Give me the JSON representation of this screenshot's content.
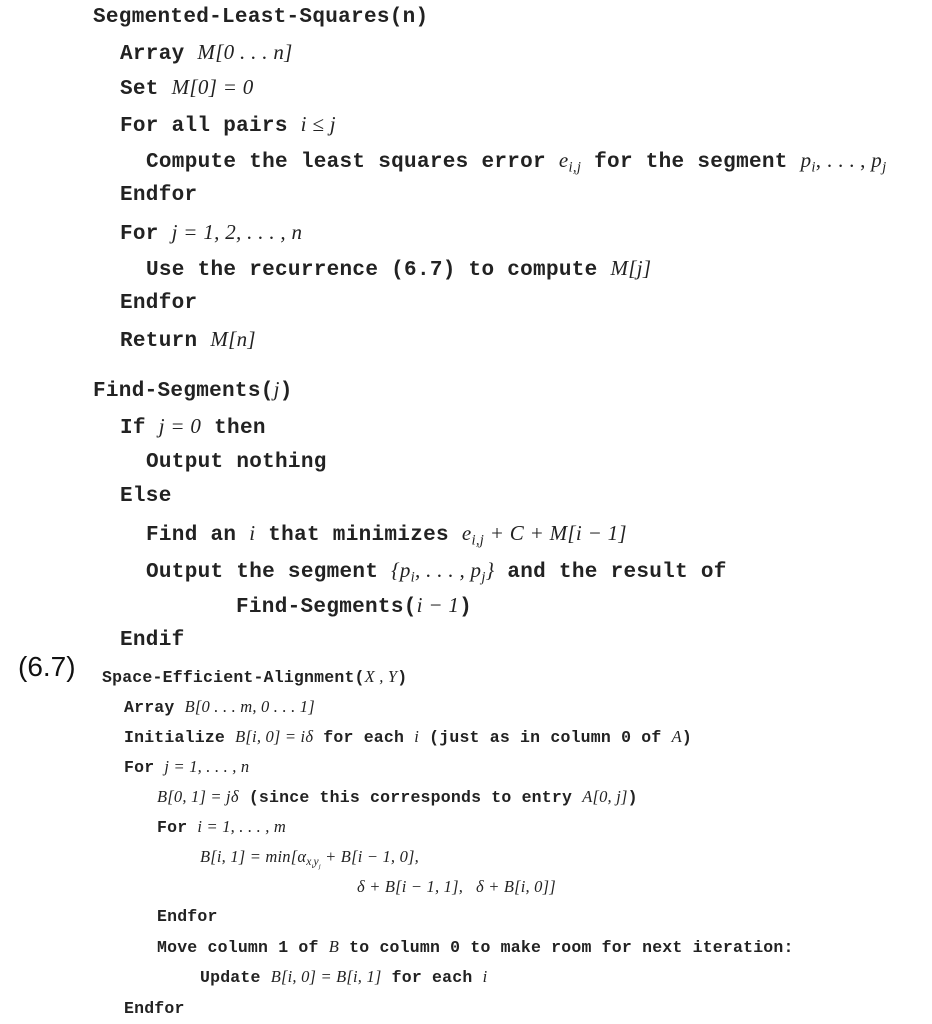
{
  "equation_label": "(6.7)",
  "segmented_least_squares": {
    "header": "Segmented-Least-Squares(n)",
    "array_kw": "Array",
    "array_expr": "M[0 . . . n]",
    "set_kw": "Set",
    "set_expr": "M[0] = 0",
    "for_pairs_kw": "For all pairs",
    "for_pairs_expr": "i ≤ j",
    "compute_kw": "Compute the least squares error",
    "compute_e": "e",
    "compute_sub": "i,j",
    "compute_mid": "for the segment",
    "compute_p1": "p",
    "compute_p1_sub": "i",
    "compute_dots": ", . . . ,",
    "compute_p2": "p",
    "compute_p2_sub": "j",
    "endfor1": "Endfor",
    "for_j_kw": "For",
    "for_j_expr": "j = 1, 2, . . . , n",
    "use_kw": "Use the recurrence (6.7) to compute",
    "use_expr": "M[j]",
    "endfor2": "Endfor",
    "return_kw": "Return",
    "return_expr": "M[n]"
  },
  "find_segments": {
    "header_kw": "Find-Segments(",
    "header_arg": "j",
    "header_close": ")",
    "if_kw": "If",
    "if_expr": "j = 0",
    "then_kw": "then",
    "output_nothing": "Output nothing",
    "else_kw": "Else",
    "find_kw": "Find an",
    "find_i": "i",
    "find_kw2": "that minimizes",
    "find_e": "e",
    "find_sub": "i,j",
    "find_rest": " + C + M[i − 1]",
    "output_kw": "Output the segment",
    "output_expr_open": "{p",
    "output_sub1": "i",
    "output_mid": ", . . . , p",
    "output_sub2": "j",
    "output_expr_close": "}",
    "output_kw2": "and the result of",
    "recurse_kw": "Find-Segments(",
    "recurse_arg": "i − 1",
    "recurse_close": ")",
    "endif": "Endif"
  },
  "space_efficient_alignment": {
    "header_kw": "Space-Efficient-Alignment(",
    "header_args": "X , Y",
    "header_close": ")",
    "array_kw": "Array",
    "array_expr": "B[0 . . . m, 0 . . . 1]",
    "init_kw": "Initialize",
    "init_expr": "B[i, 0] = iδ",
    "init_kw2": "for each",
    "init_i": "i",
    "init_kw3": "(just as in column 0 of",
    "init_A": "A",
    "init_close": ")",
    "for_j_kw": "For",
    "for_j_expr": "j = 1, . . . , n",
    "b01_expr": "B[0, 1] = jδ",
    "b01_kw": "(since this corresponds to entry",
    "b01_A": "A[0, j]",
    "b01_close": ")",
    "for_i_kw": "For",
    "for_i_expr": "i = 1, . . . , m",
    "bi1_expr": "B[i, 1] = min[α",
    "bi1_sub": "x",
    "bi1_subsub1": "i",
    "bi1_sub2": "y",
    "bi1_subsub2": "j",
    "bi1_rest": " + B[i − 1, 0],",
    "bi1_line2": "δ + B[i − 1, 1],   δ + B[i, 0]]",
    "endfor_inner": "Endfor",
    "move_kw": "Move column 1 of",
    "move_B": "B",
    "move_kw2": "to column 0 to make room for next iteration:",
    "update_kw": "Update",
    "update_expr": "B[i, 0] = B[i, 1]",
    "update_kw2": "for each",
    "update_i": "i",
    "endfor_outer": "Endfor"
  }
}
